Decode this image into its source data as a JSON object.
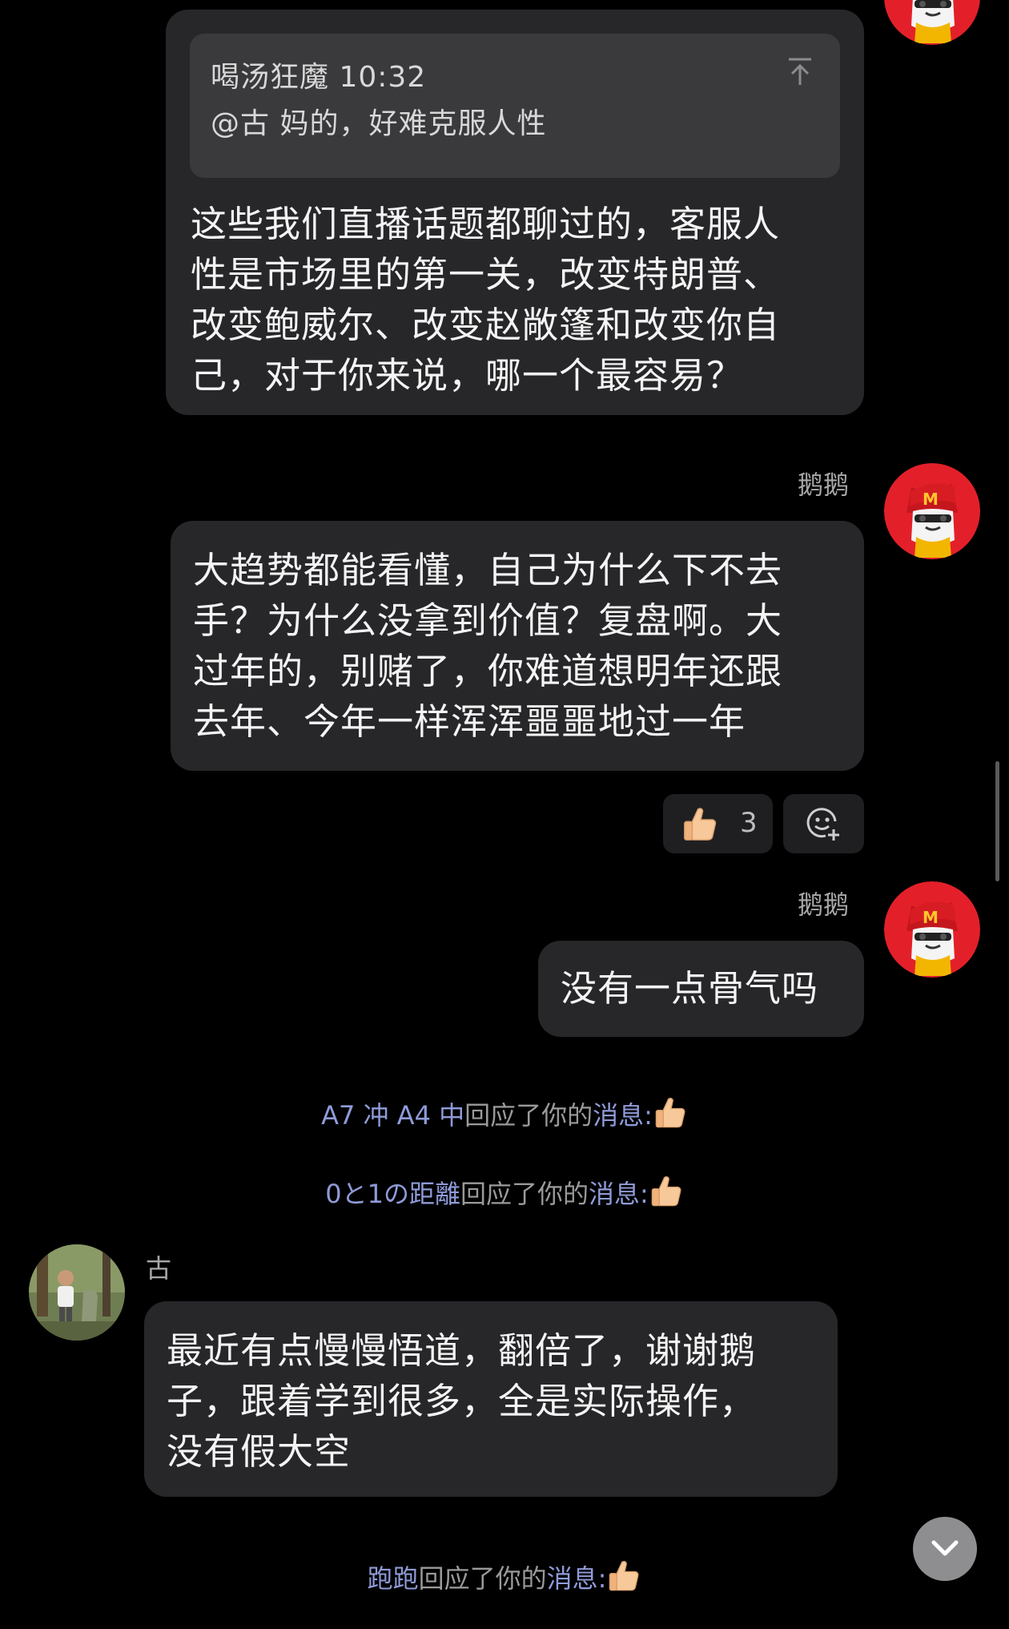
{
  "messages": {
    "m1": {
      "quote_sender": "喝汤狂魔",
      "quote_time": "10:32",
      "quote_text": "@古 妈的，好难克服人性",
      "lines": [
        "这些我们直播话题都聊过的，客服人",
        "性是市场里的第一关，改变特朗普、",
        "改变鲍威尔、改变赵敞篷和改变你自",
        "己，对于你来说，哪一个最容易？"
      ]
    },
    "m2": {
      "sender": "鹅鹅",
      "lines": [
        "大趋势都能看懂，自己为什么下不去",
        "手？为什么没拿到价值？复盘啊。大",
        "过年的，别赌了，你难道想明年还跟",
        "去年、今年一样浑浑噩噩地过一年"
      ],
      "reaction_count": "3"
    },
    "m3": {
      "sender": "鹅鹅",
      "text": "没有一点骨气吗"
    },
    "m4": {
      "sender": "古",
      "lines": [
        "最近有点慢慢悟道，翻倍了，谢谢鹅",
        "子，跟着学到很多，全是实际操作，",
        "没有假大空"
      ]
    }
  },
  "system": {
    "r1": {
      "nick": "A7 冲 A4 中",
      "mid": "回应了你的",
      "tail": "消息:"
    },
    "r2": {
      "nick": "0と1の距離",
      "mid": "回应了你的",
      "tail": "消息:"
    },
    "r3": {
      "nick": "跑跑",
      "mid": "回应了你的",
      "tail": "消息:"
    }
  },
  "icons": {
    "thumbs_up": "👍",
    "avatar_self": "red-cartoon-mascot",
    "avatar_other": "person-photo"
  },
  "colors": {
    "bubble": "#27272a",
    "nick": "#8f9bd8",
    "avatar_red": "#e3202a"
  }
}
